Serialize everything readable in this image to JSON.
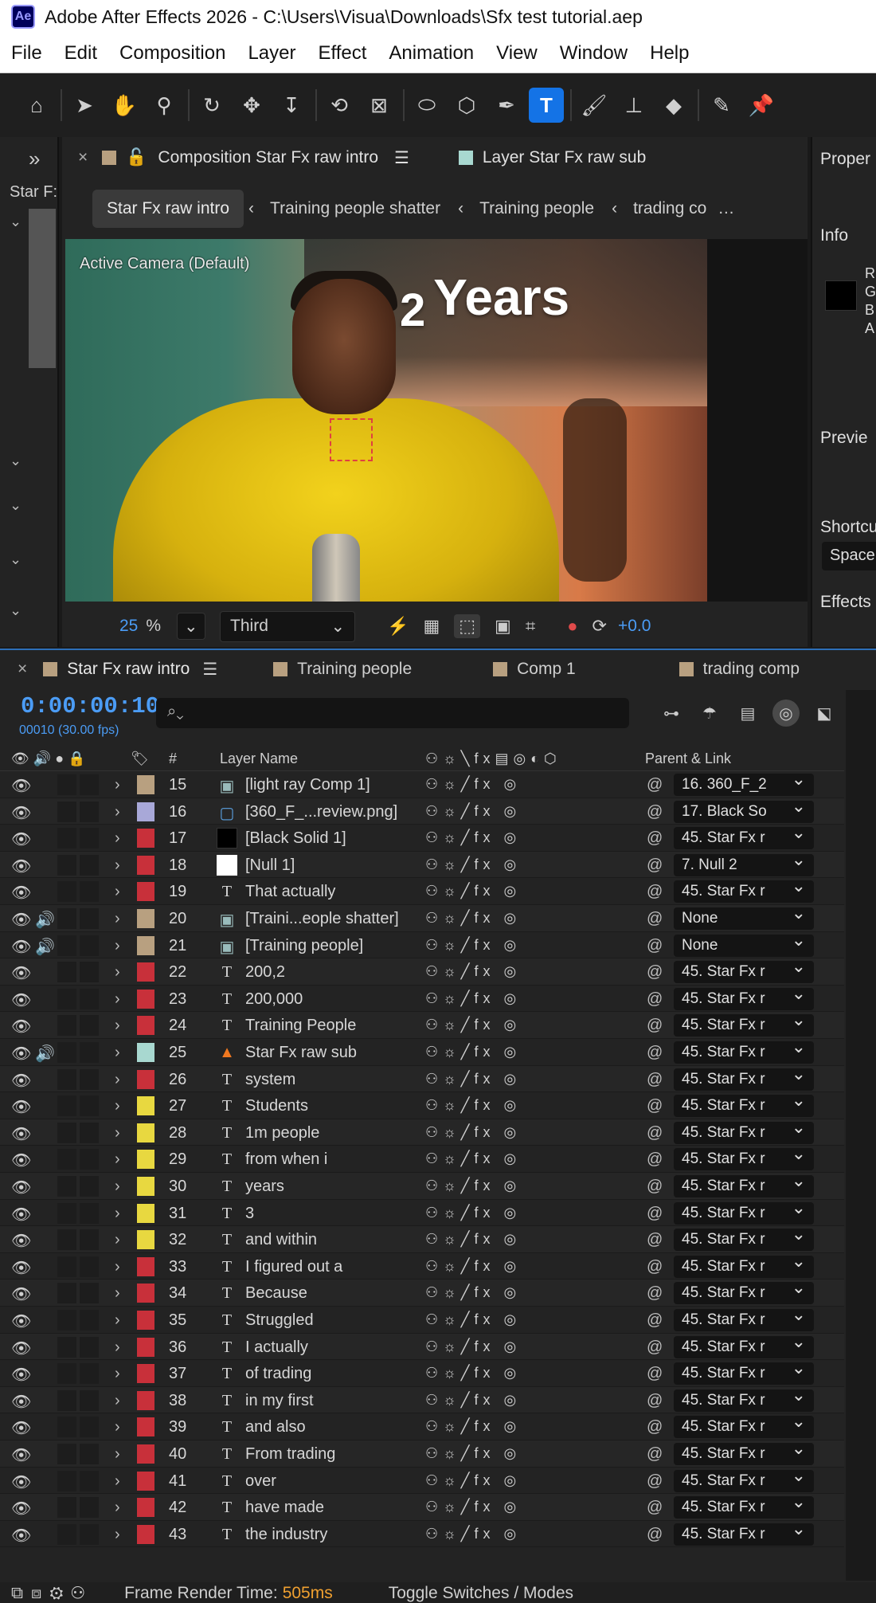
{
  "window": {
    "title": "Adobe After Effects 2026 - C:\\Users\\Visua\\Downloads\\Sfx test tutorial.aep",
    "logo": "Ae"
  },
  "menu": [
    "File",
    "Edit",
    "Composition",
    "Layer",
    "Effect",
    "Animation",
    "View",
    "Window",
    "Help"
  ],
  "tools": [
    "home-icon",
    "selection-icon",
    "hand-icon",
    "zoom-icon",
    "orbit-icon",
    "pan-icon",
    "dolly-icon",
    "rotate-icon",
    "pan-behind-icon",
    "ellipse-icon",
    "cube-icon",
    "pen-icon",
    "type-icon",
    "brush-icon",
    "clone-stamp-icon",
    "eraser-icon",
    "roto-brush-icon",
    "puppet-pin-icon"
  ],
  "left_strip": {
    "collapse": "»",
    "label": "Star F:"
  },
  "comp_panel": {
    "tab_close": "×",
    "tab_title": "Composition Star Fx raw intro",
    "tab_menu": "☰",
    "layer_tab": "Layer Star Fx raw sub",
    "breadcrumbs": [
      "Star Fx raw intro",
      "Training people shatter",
      "Training people",
      "trading co"
    ],
    "viewer_label": "Active Camera (Default)",
    "overlay_number": "2",
    "overlay_text": "Years",
    "zoom": "25",
    "zoom_unit": "%",
    "resolution": "Third",
    "exposure": "+0.0"
  },
  "right_panel": {
    "properties": "Proper",
    "info": "Info",
    "rgba": [
      "R",
      "G",
      "B",
      "A"
    ],
    "preview": "Previe",
    "shortcuts": "Shortcu",
    "space": "Space",
    "effects": "Effects"
  },
  "timeline": {
    "tabs": [
      {
        "label": "Star Fx raw intro",
        "color": "#b8a080",
        "active": true
      },
      {
        "label": "Training people",
        "color": "#b8a080"
      },
      {
        "label": "Comp 1",
        "color": "#b8a080"
      },
      {
        "label": "trading comp",
        "color": "#b8a080"
      }
    ],
    "timecode": "0:00:00:10",
    "frame_info": "00010 (30.00 fps)",
    "search_placeholder": "⌕⌄",
    "headers": {
      "num": "#",
      "layer_name": "Layer Name",
      "parent": "Parent & Link"
    },
    "layers": [
      {
        "num": "15",
        "icon": "comp",
        "name": "[light ray Comp 1]",
        "color": "#b8a080",
        "parent": "16. 360_F_2",
        "audio": false
      },
      {
        "num": "16",
        "icon": "image",
        "name": "[360_F_...review.png]",
        "color": "#a8a8d8",
        "parent": "17. Black So",
        "audio": false
      },
      {
        "num": "17",
        "icon": "solid-black",
        "name": "[Black Solid 1]",
        "color": "#c8303a",
        "parent": "45. Star Fx r",
        "audio": false
      },
      {
        "num": "18",
        "icon": "solid-white",
        "name": "[Null 1]",
        "color": "#c8303a",
        "parent": "7. Null 2",
        "audio": false
      },
      {
        "num": "19",
        "icon": "T",
        "name": "That actually",
        "color": "#c8303a",
        "parent": "45. Star Fx r",
        "audio": false
      },
      {
        "num": "20",
        "icon": "comp",
        "name": "[Traini...eople shatter]",
        "color": "#b8a080",
        "parent": "None",
        "audio": true
      },
      {
        "num": "21",
        "icon": "comp",
        "name": "[Training people]",
        "color": "#b8a080",
        "parent": "None",
        "audio": true
      },
      {
        "num": "22",
        "icon": "T",
        "name": "200,2",
        "color": "#c8303a",
        "parent": "45. Star Fx r",
        "audio": false
      },
      {
        "num": "23",
        "icon": "T",
        "name": "200,000",
        "color": "#c8303a",
        "parent": "45. Star Fx r",
        "audio": false
      },
      {
        "num": "24",
        "icon": "T",
        "name": "Training People",
        "color": "#c8303a",
        "parent": "45. Star Fx r",
        "audio": false
      },
      {
        "num": "25",
        "icon": "cone",
        "name": "Star Fx raw sub",
        "color": "#a8d8d0",
        "parent": "45. Star Fx r",
        "audio": true
      },
      {
        "num": "26",
        "icon": "T",
        "name": "system",
        "color": "#c8303a",
        "parent": "45. Star Fx r",
        "audio": false
      },
      {
        "num": "27",
        "icon": "T",
        "name": "Students",
        "color": "#e8d840",
        "parent": "45. Star Fx r",
        "audio": false
      },
      {
        "num": "28",
        "icon": "T",
        "name": "1m people",
        "color": "#e8d840",
        "parent": "45. Star Fx r",
        "audio": false
      },
      {
        "num": "29",
        "icon": "T",
        "name": "from when i",
        "color": "#e8d840",
        "parent": "45. Star Fx r",
        "audio": false
      },
      {
        "num": "30",
        "icon": "T",
        "name": "years",
        "color": "#e8d840",
        "parent": "45. Star Fx r",
        "audio": false
      },
      {
        "num": "31",
        "icon": "T",
        "name": "3",
        "color": "#e8d840",
        "parent": "45. Star Fx r",
        "audio": false
      },
      {
        "num": "32",
        "icon": "T",
        "name": "and within",
        "color": "#e8d840",
        "parent": "45. Star Fx r",
        "audio": false
      },
      {
        "num": "33",
        "icon": "T",
        "name": "I figured out a",
        "color": "#c8303a",
        "parent": "45. Star Fx r",
        "audio": false
      },
      {
        "num": "34",
        "icon": "T",
        "name": "Because",
        "color": "#c8303a",
        "parent": "45. Star Fx r",
        "audio": false
      },
      {
        "num": "35",
        "icon": "T",
        "name": "Struggled",
        "color": "#c8303a",
        "parent": "45. Star Fx r",
        "audio": false
      },
      {
        "num": "36",
        "icon": "T",
        "name": "I actually",
        "color": "#c8303a",
        "parent": "45. Star Fx r",
        "audio": false
      },
      {
        "num": "37",
        "icon": "T",
        "name": "of trading",
        "color": "#c8303a",
        "parent": "45. Star Fx r",
        "audio": false
      },
      {
        "num": "38",
        "icon": "T",
        "name": "in my first",
        "color": "#c8303a",
        "parent": "45. Star Fx r",
        "audio": false
      },
      {
        "num": "39",
        "icon": "T",
        "name": "and also",
        "color": "#c8303a",
        "parent": "45. Star Fx r",
        "audio": false
      },
      {
        "num": "40",
        "icon": "T",
        "name": "From trading",
        "color": "#c8303a",
        "parent": "45. Star Fx r",
        "audio": false
      },
      {
        "num": "41",
        "icon": "T",
        "name": "over",
        "color": "#c8303a",
        "parent": "45. Star Fx r",
        "audio": false
      },
      {
        "num": "42",
        "icon": "T",
        "name": "have made",
        "color": "#c8303a",
        "parent": "45. Star Fx r",
        "audio": false
      },
      {
        "num": "43",
        "icon": "T",
        "name": "the industry",
        "color": "#c8303a",
        "parent": "45. Star Fx r",
        "audio": false
      }
    ]
  },
  "status": {
    "render_label": "Frame Render Time:",
    "render_value": "505ms",
    "toggle": "Toggle Switches / Modes"
  }
}
